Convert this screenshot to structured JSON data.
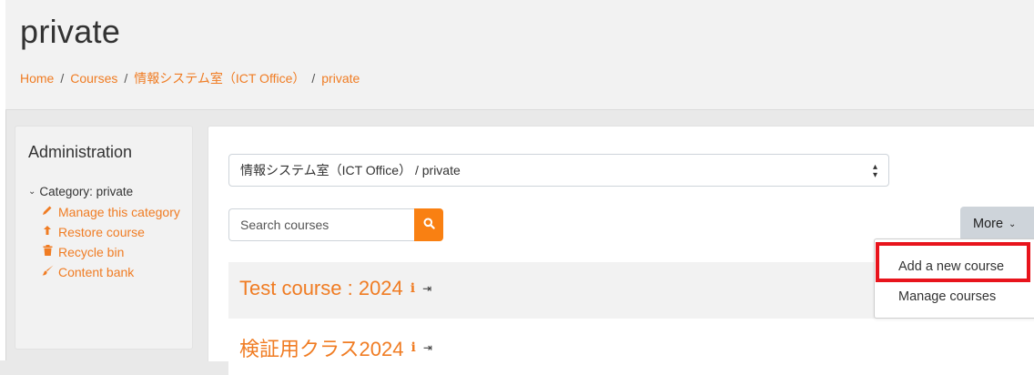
{
  "header": {
    "title": "private",
    "breadcrumb": [
      {
        "label": "Home"
      },
      {
        "label": "Courses"
      },
      {
        "label": "情報システム室（ICT Office）"
      },
      {
        "label": "private"
      }
    ]
  },
  "admin": {
    "title": "Administration",
    "category_label": "Category: private",
    "links": [
      {
        "label": "Manage this category",
        "icon": "pencil-icon"
      },
      {
        "label": "Restore course",
        "icon": "upload-icon"
      },
      {
        "label": "Recycle bin",
        "icon": "trash-icon"
      },
      {
        "label": "Content bank",
        "icon": "paint-brush-icon"
      }
    ]
  },
  "category_select": {
    "value": "情報システム室（ICT Office） / private"
  },
  "search": {
    "placeholder": "Search courses",
    "button_icon": "search-icon"
  },
  "more_button": {
    "label": "More"
  },
  "courses": [
    {
      "name": "Test course : 2024"
    },
    {
      "name": "検証用クラス2024"
    }
  ],
  "dropdown": {
    "items": [
      {
        "label": "Add a new course"
      },
      {
        "label": "Manage courses"
      }
    ]
  },
  "colors": {
    "accent": "#f07c23",
    "search_button": "#f98012",
    "highlight": "#e8141c",
    "more_button": "#ced4da"
  }
}
